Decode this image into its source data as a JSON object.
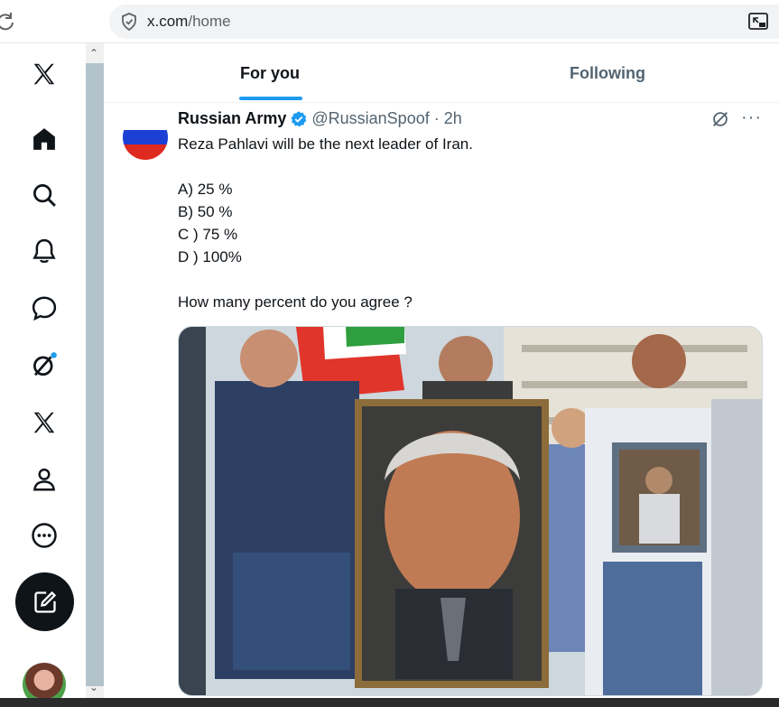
{
  "browser": {
    "url_host": "x.com",
    "url_path": "/home"
  },
  "sidebar": {
    "items": [
      {
        "name": "x-logo-icon"
      },
      {
        "name": "home-icon"
      },
      {
        "name": "search-icon"
      },
      {
        "name": "notifications-icon"
      },
      {
        "name": "messages-icon"
      },
      {
        "name": "grok-icon"
      },
      {
        "name": "premium-x-icon"
      },
      {
        "name": "profile-icon"
      },
      {
        "name": "more-icon"
      }
    ]
  },
  "tabs": {
    "for_you": "For you",
    "following": "Following"
  },
  "tweet": {
    "display_name": "Russian Army",
    "handle_time": "@RussianSpoof · 2h",
    "lines": [
      "Reza Pahlavi will be the next leader of Iran.",
      "",
      "A) 25 %",
      "B) 50 %",
      "C ) 75 %",
      "D ) 100%",
      "",
      "How many percent do you agree ?"
    ]
  },
  "colors": {
    "accent": "#1d9bf0",
    "text_primary": "#0f1419",
    "text_secondary": "#536471"
  }
}
